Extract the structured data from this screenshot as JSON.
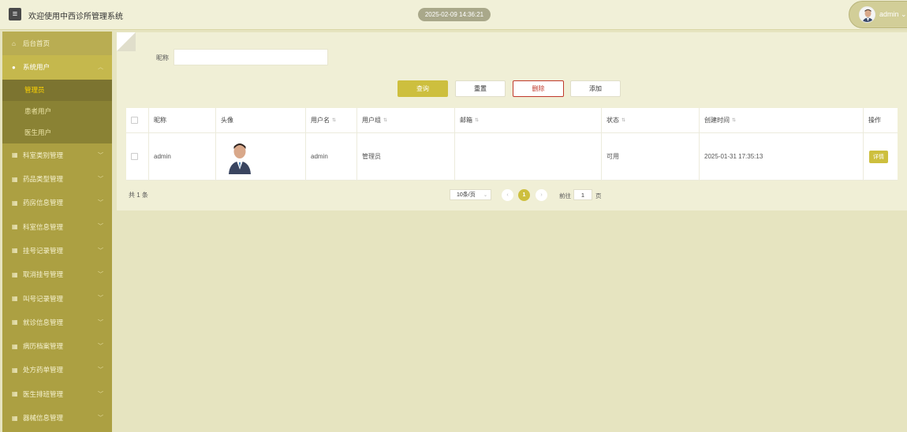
{
  "header": {
    "title": "欢迎使用中西诊所管理系统",
    "datetime": "2025-02-09 14:36:21",
    "user": "admin",
    "user_chevron": "⌄"
  },
  "sidebar": {
    "items": [
      {
        "label": "后台首页",
        "icon": "home-icon"
      },
      {
        "label": "系统用户",
        "icon": "user-icon",
        "expanded": true,
        "children": [
          {
            "label": "管理员",
            "active": true
          },
          {
            "label": "患者用户"
          },
          {
            "label": "医生用户"
          }
        ]
      },
      {
        "label": "科室类别管理",
        "icon": "grid-icon"
      },
      {
        "label": "药品类型管理",
        "icon": "grid-icon"
      },
      {
        "label": "药房信息管理",
        "icon": "grid-icon"
      },
      {
        "label": "科室信息管理",
        "icon": "grid-icon"
      },
      {
        "label": "挂号记录管理",
        "icon": "grid-icon"
      },
      {
        "label": "取消挂号管理",
        "icon": "grid-icon"
      },
      {
        "label": "叫号记录管理",
        "icon": "grid-icon"
      },
      {
        "label": "就诊信息管理",
        "icon": "grid-icon"
      },
      {
        "label": "病历档案管理",
        "icon": "grid-icon"
      },
      {
        "label": "处方药单管理",
        "icon": "grid-icon"
      },
      {
        "label": "医生排班管理",
        "icon": "grid-icon"
      },
      {
        "label": "器械信息管理",
        "icon": "grid-icon"
      }
    ]
  },
  "search": {
    "label": "昵称",
    "value": "",
    "placeholder": ""
  },
  "buttons": {
    "query": "查询",
    "reset": "重置",
    "delete": "删除",
    "add": "添加"
  },
  "table": {
    "columns": [
      "",
      "昵称",
      "头像",
      "用户名",
      "用户组",
      "邮箱",
      "状态",
      "创建时间",
      "操作"
    ],
    "sortable": [
      false,
      false,
      false,
      true,
      true,
      true,
      true,
      true,
      false
    ],
    "rows": [
      {
        "nickname": "admin",
        "username": "admin",
        "group": "管理员",
        "email": "",
        "status": "可用",
        "created": "2025-01-31 17:35:13",
        "action": "详情"
      }
    ]
  },
  "pagination": {
    "total": "共 1 条",
    "page_size": "10条/页",
    "current": "1",
    "goto_label": "前往",
    "goto_value": "1",
    "goto_suffix": "页"
  },
  "colors": {
    "accent": "#cdbf3e",
    "sidebar": "#aca042",
    "background": "#e6e4c0"
  }
}
